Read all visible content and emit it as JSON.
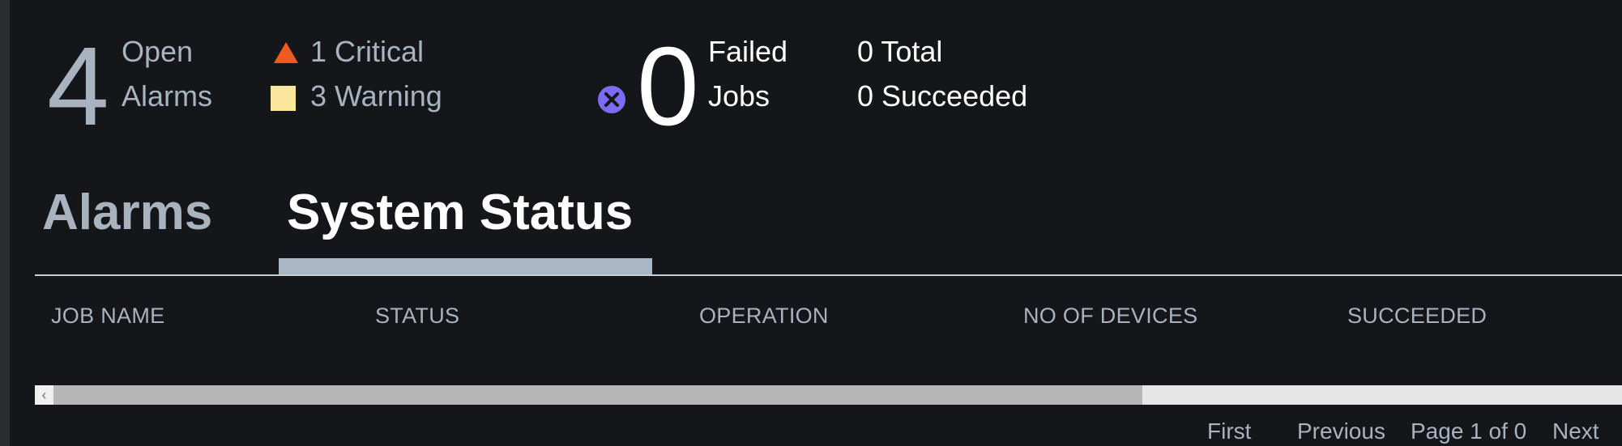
{
  "summary": {
    "alarms": {
      "count": "4",
      "label_line1": "Open",
      "label_line2": "Alarms",
      "critical": "1 Critical",
      "warning": "3 Warning",
      "critical_color": "#f05a22",
      "warning_color": "#fbe79b"
    },
    "jobs": {
      "status_icon": "failed-x-icon",
      "count": "0",
      "label_line1": "Failed",
      "label_line2": "Jobs",
      "total": "0 Total",
      "succeeded": "0 Succeeded",
      "icon_color": "#7b6cf5"
    }
  },
  "tabs": [
    {
      "label": "Alarms",
      "active": false
    },
    {
      "label": "System Status",
      "active": true
    }
  ],
  "table": {
    "columns": [
      "JOB NAME",
      "STATUS",
      "OPERATION",
      "NO OF DEVICES",
      "SUCCEEDED"
    ],
    "rows": []
  },
  "pagination": {
    "first": "First",
    "previous": "Previous",
    "page_info": "Page 1 of 0",
    "next": "Next"
  }
}
